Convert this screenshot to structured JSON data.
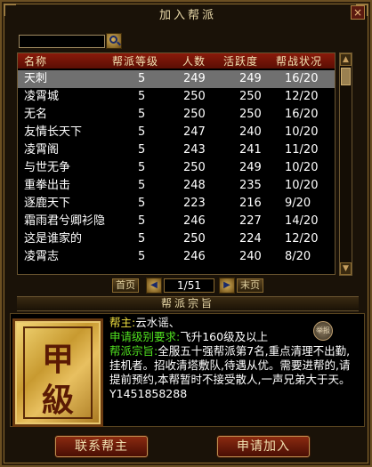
{
  "window": {
    "title": "加入帮派",
    "close": "×"
  },
  "search": {
    "value": "",
    "placeholder": ""
  },
  "table": {
    "headers": [
      "名称",
      "帮派等级",
      "人数",
      "活跃度",
      "帮战状况"
    ],
    "rows": [
      [
        "天刺",
        "5",
        "249",
        "249",
        "16/20"
      ],
      [
        "凌霄城",
        "5",
        "250",
        "250",
        "12/20"
      ],
      [
        "无名",
        "5",
        "250",
        "250",
        "16/20"
      ],
      [
        "友情长天下",
        "5",
        "247",
        "240",
        "10/20"
      ],
      [
        "凌霄阁",
        "5",
        "243",
        "241",
        "11/20"
      ],
      [
        "与世无争",
        "5",
        "250",
        "249",
        "10/20"
      ],
      [
        "重拳出击",
        "5",
        "248",
        "235",
        "10/20"
      ],
      [
        "逐鹿天下",
        "5",
        "223",
        "216",
        "9/20"
      ],
      [
        "霜雨君兮卿衫隐",
        "5",
        "246",
        "227",
        "14/20"
      ],
      [
        "这是谁家的",
        "5",
        "250",
        "224",
        "12/20"
      ],
      [
        "凌霄志",
        "5",
        "246",
        "240",
        "8/20"
      ]
    ],
    "selected_index": 0
  },
  "pager": {
    "first": "首页",
    "last": "末页",
    "page": "1/51"
  },
  "guild_info": {
    "section_title": "帮派宗旨",
    "plaque": [
      "甲",
      "級"
    ],
    "badge": "举报",
    "leader_label": "帮主:",
    "leader": "云水谣、",
    "requirement_label": "申请级别要求:",
    "requirement": "飞升160级及以上",
    "purpose_label": "帮派宗旨:",
    "purpose": "全服五十强帮派第7名,重点清理不出勤,挂机者。招收清塔敷队,待遇从优。需要进帮的,请提前预约,本帮暂时不接受散人,一声兄弟大于天。Y1451858288"
  },
  "buttons": {
    "contact": "联系帮主",
    "apply": "申请加入"
  },
  "colors": {
    "header_red": "#8a1a0a",
    "label_yellow": "#f0e040",
    "value_green": "#50e020",
    "selected_gray": "#707070"
  }
}
